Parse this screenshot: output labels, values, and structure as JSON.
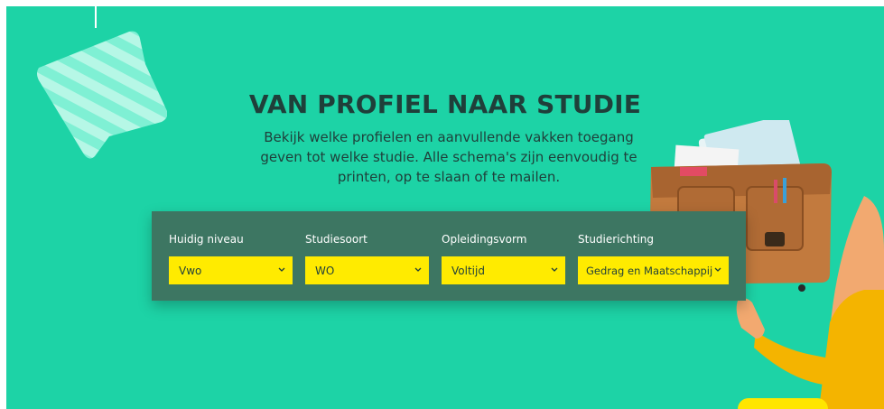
{
  "hero": {
    "title": "VAN PROFIEL NAAR STUDIE",
    "subtitle": "Bekijk welke profielen en aanvullende vakken toegang geven tot welke studie. Alle schema's zijn eenvoudig te printen, op te slaan of te mailen."
  },
  "filters": [
    {
      "label": "Huidig niveau",
      "value": "Vwo"
    },
    {
      "label": "Studiesoort",
      "value": "WO"
    },
    {
      "label": "Opleidingsvorm",
      "value": "Voltijd"
    },
    {
      "label": "Studierichting",
      "value": "Gedrag en Maatschappij"
    }
  ],
  "colors": {
    "background": "#1dd3a6",
    "panel": "#3d7662",
    "select": "#ffeb00",
    "text": "#1f3f3a"
  },
  "icons": {
    "decoration_arrow": "striped-arrow-icon",
    "decoration_bag": "school-bag-icon",
    "dropdown": "chevron-down-icon"
  }
}
